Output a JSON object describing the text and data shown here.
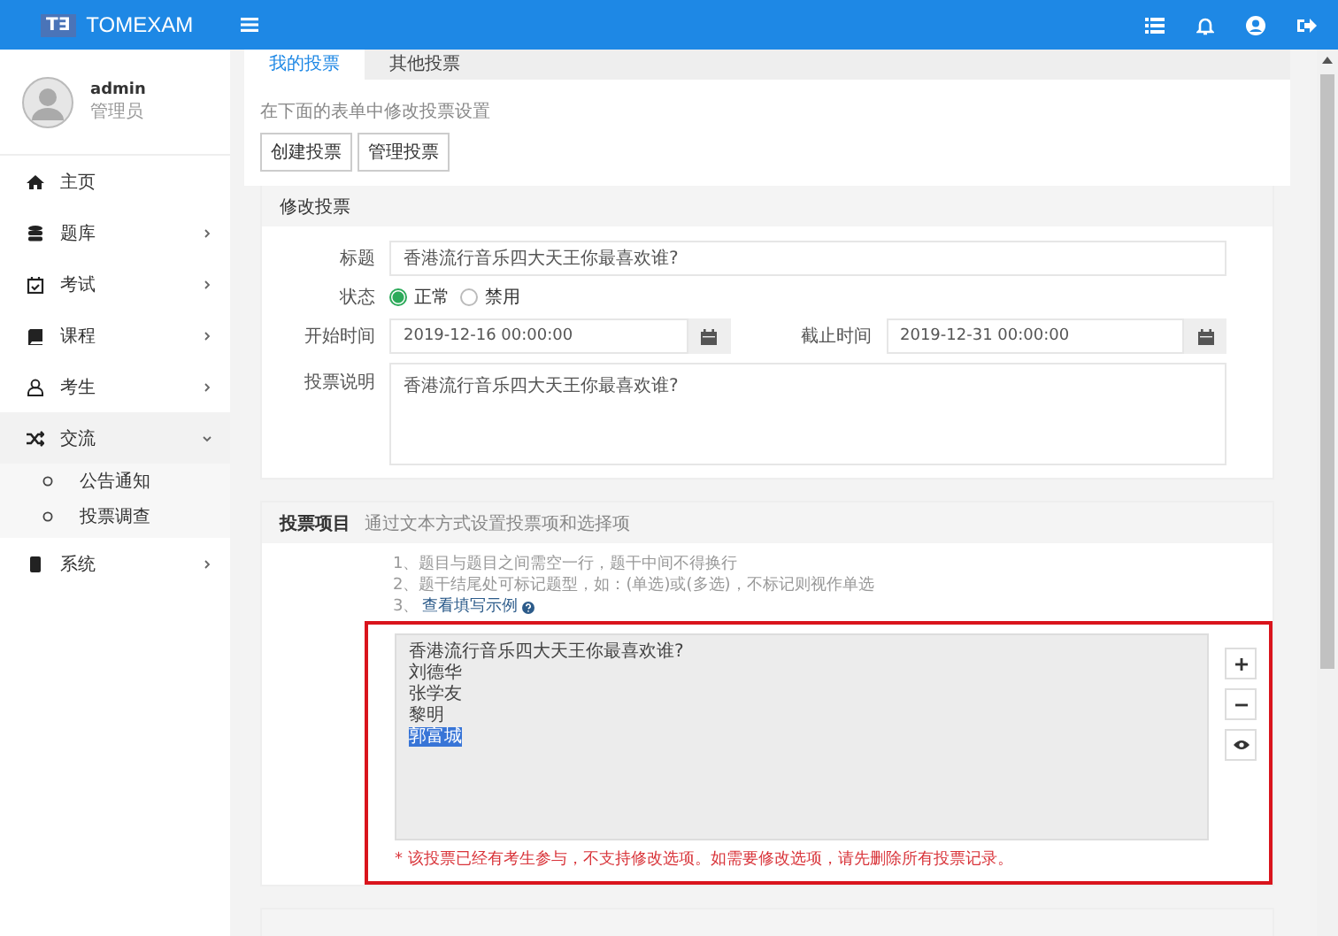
{
  "brand": {
    "logo": "T∃",
    "name": "TOMEXAM"
  },
  "user": {
    "name": "admin",
    "role": "管理员"
  },
  "nav": [
    {
      "label": "主页",
      "kind": "link",
      "expanded": false
    },
    {
      "label": "题库",
      "kind": "group",
      "expanded": false
    },
    {
      "label": "考试",
      "kind": "group",
      "expanded": false
    },
    {
      "label": "课程",
      "kind": "group",
      "expanded": false
    },
    {
      "label": "考生",
      "kind": "group",
      "expanded": false
    },
    {
      "label": "交流",
      "kind": "group",
      "expanded": true,
      "children": [
        {
          "label": "公告通知"
        },
        {
          "label": "投票调查"
        }
      ]
    },
    {
      "label": "系统",
      "kind": "group",
      "expanded": false
    }
  ],
  "tabs": [
    {
      "label": "我的投票",
      "selected": true
    },
    {
      "label": "其他投票",
      "selected": false
    }
  ],
  "hint": "在下面的表单中修改投票设置",
  "buttons": [
    "创建投票",
    "管理投票"
  ],
  "edit_panel": {
    "title": "修改投票",
    "title_field": {
      "label": "标题",
      "value": "香港流行音乐四大天王你最喜欢谁?"
    },
    "status": {
      "label": "状态",
      "options": [
        {
          "label": "正常",
          "selected": true
        },
        {
          "label": "禁用",
          "selected": false
        }
      ]
    },
    "start_time": {
      "label": "开始时间",
      "value": "2019-12-16 00:00:00"
    },
    "end_time": {
      "label": "截止时间",
      "value": "2019-12-31 00:00:00"
    },
    "description": {
      "label": "投票说明",
      "value": "香港流行音乐四大天王你最喜欢谁?"
    }
  },
  "items_panel": {
    "title": "投票项目",
    "subtitle": "通过文本方式设置投票项和选择项",
    "instructions": [
      "1、题目与题目之间需空一行，题干中间不得换行",
      "2、题干结尾处可标记题型，如：(单选)或(多选)，不标记则视作单选"
    ],
    "example_prefix": "3、",
    "example_link": "查看填写示例",
    "options_disabled": true,
    "option_lines": [
      {
        "text": "香港流行音乐四大天王你最喜欢谁?",
        "selected": false
      },
      {
        "text": "刘德华",
        "selected": false
      },
      {
        "text": "张学友",
        "selected": false
      },
      {
        "text": "黎明",
        "selected": false
      },
      {
        "text": "郭富城",
        "selected": true
      }
    ],
    "error": "* 该投票已经有考生参与，不支持修改选项。如需要修改选项，请先删除所有投票记录。",
    "highlighted": true
  }
}
